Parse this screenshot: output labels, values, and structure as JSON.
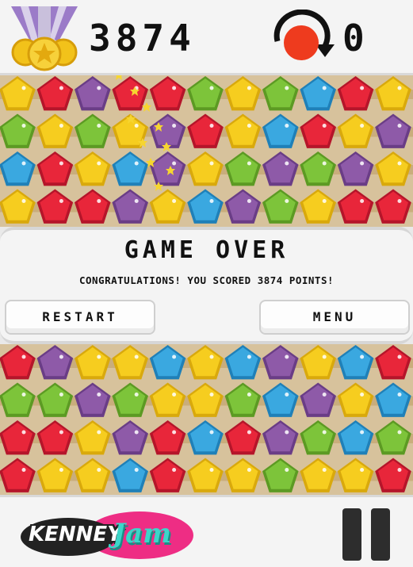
{
  "hud": {
    "score": "3874",
    "undo_count": "0",
    "medal_icon": "gold-medal-icon",
    "undo_icon": "undo-arrow-icon"
  },
  "game_over": {
    "title": "GAME OVER",
    "message": "CONGRATULATIONS! YOU SCORED 3874 POINTS!",
    "restart_label": "RESTART",
    "menu_label": "MENU"
  },
  "branding": {
    "logo_left": "KENNEY",
    "logo_right": "Jam"
  },
  "colors": {
    "yellow": "#f6cd1f",
    "red": "#e8263a",
    "purple": "#8e5aa8",
    "green": "#7dc43a",
    "blue": "#3aa8e0",
    "board": "#d7c29c",
    "undo_red": "#ee3b1e"
  },
  "board_top": {
    "rows": [
      [
        "yellow",
        "red",
        "purple",
        "red",
        "red",
        "green",
        "yellow",
        "green",
        "blue",
        "red",
        "yellow"
      ],
      [
        "green",
        "yellow",
        "green",
        "yellow",
        "purple",
        "red",
        "yellow",
        "blue",
        "red",
        "yellow",
        "purple"
      ],
      [
        "blue",
        "red",
        "yellow",
        "blue",
        "purple",
        "yellow",
        "green",
        "purple",
        "green",
        "purple",
        "yellow"
      ],
      [
        "yellow",
        "red",
        "red",
        "purple",
        "yellow",
        "blue",
        "purple",
        "green",
        "yellow",
        "red",
        "red"
      ]
    ]
  },
  "board_bottom": {
    "rows": [
      [
        "red",
        "purple",
        "yellow",
        "yellow",
        "blue",
        "yellow",
        "blue",
        "purple",
        "yellow",
        "blue",
        "red"
      ],
      [
        "green",
        "green",
        "purple",
        "green",
        "yellow",
        "yellow",
        "green",
        "blue",
        "purple",
        "yellow",
        "blue"
      ],
      [
        "red",
        "red",
        "yellow",
        "purple",
        "red",
        "blue",
        "red",
        "purple",
        "green",
        "blue",
        "green"
      ],
      [
        "red",
        "yellow",
        "yellow",
        "blue",
        "red",
        "yellow",
        "yellow",
        "green",
        "yellow",
        "yellow",
        "red"
      ]
    ]
  },
  "pause_icon": "pause-icon"
}
